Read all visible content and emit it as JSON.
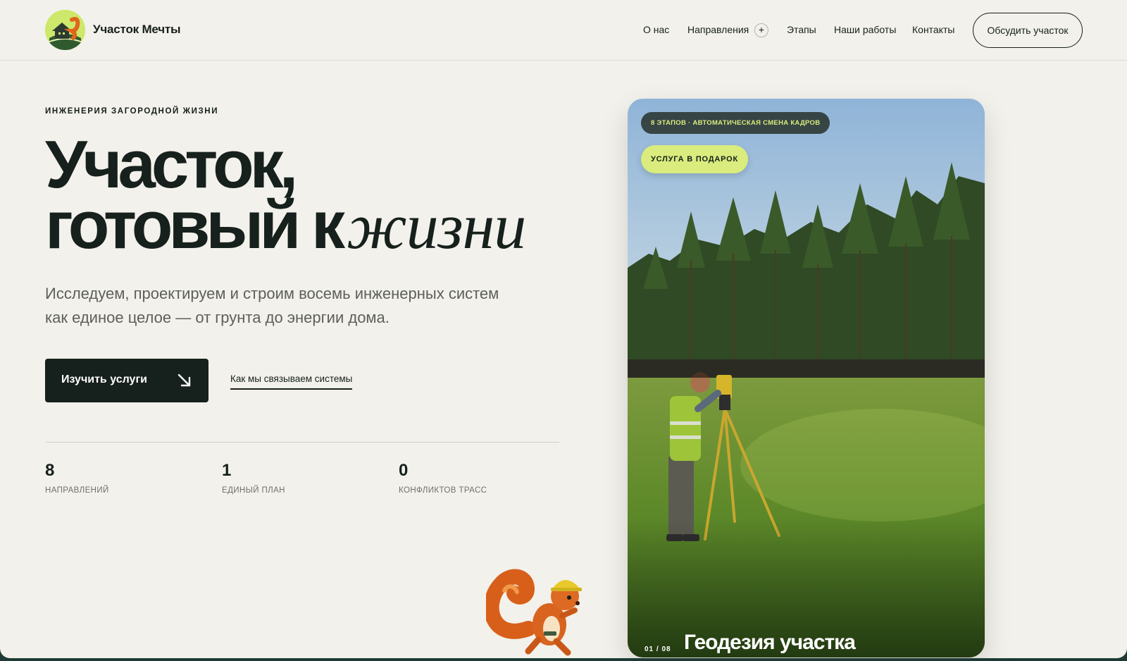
{
  "header": {
    "brand": "Участок Мечты",
    "nav": [
      {
        "label": "О нас"
      },
      {
        "label": "Направления",
        "has_expand": true
      },
      {
        "label": "Этапы"
      },
      {
        "label": "Наши работы"
      },
      {
        "label": "Контакты"
      }
    ],
    "expand_glyph": "+",
    "cta_label": "Обсудить участок"
  },
  "hero": {
    "eyebrow": "ИНЖЕНЕРИЯ ЗАГОРОДНОЙ ЖИЗНИ",
    "title_line1": "Участок,",
    "title_line2_plain": "готовый к",
    "title_line2_italic": "жизни",
    "lead": "Исследуем, проектируем и строим восемь инженерных систем как единое целое — от грунта до энергии дома.",
    "primary_button": "Изучить услуги",
    "secondary_link": "Как мы связываем системы",
    "stats": [
      {
        "value": "8",
        "label": "НАПРАВЛЕНИЙ"
      },
      {
        "value": "1",
        "label": "ЕДИНЫЙ ПЛАН"
      },
      {
        "value": "0",
        "label": "КОНФЛИКТОВ ТРАСС"
      }
    ]
  },
  "slider": {
    "tag": "8 ЭТАПОВ · АВТОМАТИЧЕСКАЯ СМЕНА КАДРОВ",
    "gift_badge": "УСЛУГА В ПОДАРОК",
    "counter": "01 / 08",
    "slide_title": "Геодезия участка"
  },
  "icons": {
    "logo": "squirrel-house-logo-icon",
    "button_arrow": "arrow-down-right-icon",
    "mascot": "squirrel-mascot-icon"
  },
  "colors": {
    "background": "#f3f1eb",
    "ink": "#16201c",
    "accent_lime": "#d9ec7d",
    "muted_text": "#5d605b"
  }
}
